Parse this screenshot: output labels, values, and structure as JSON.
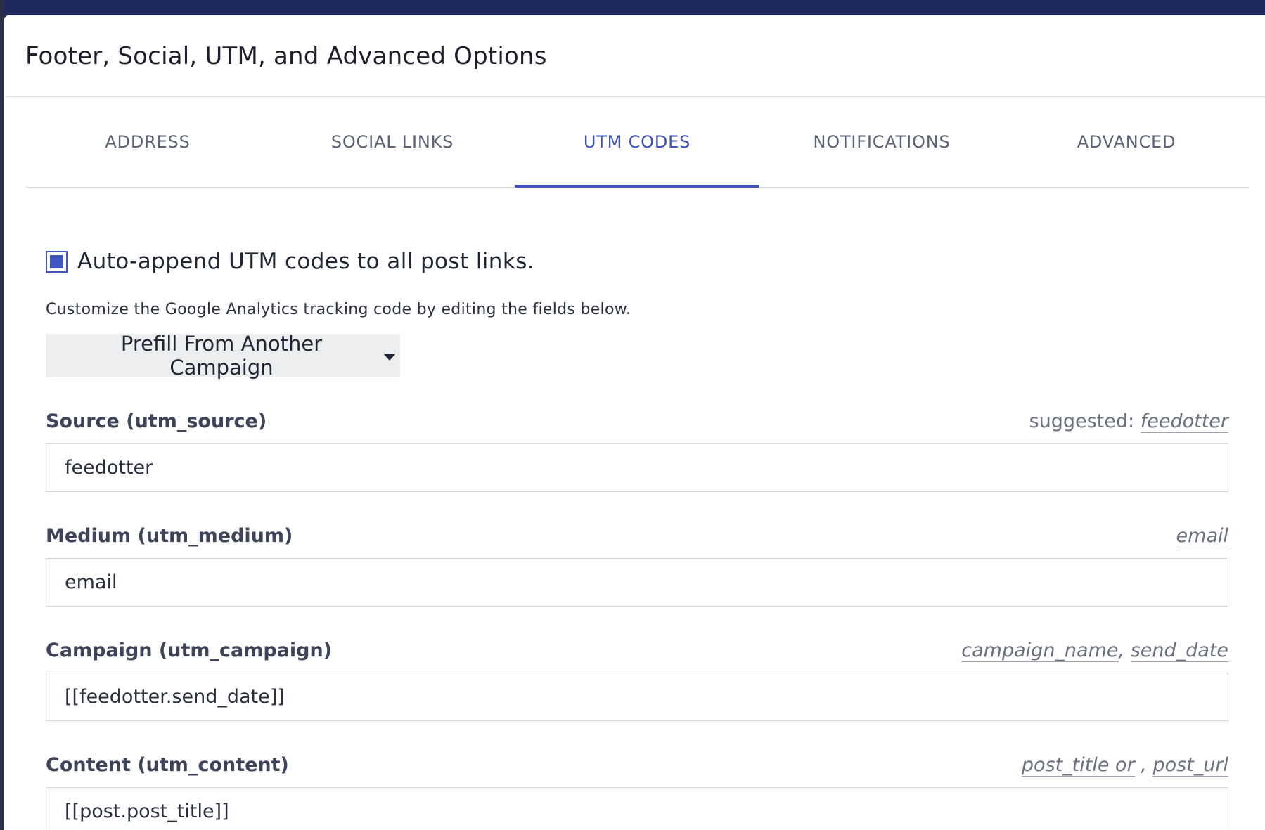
{
  "modal": {
    "title": "Footer, Social, UTM, and Advanced Options"
  },
  "tabs": [
    {
      "label": "ADDRESS",
      "active": false
    },
    {
      "label": "SOCIAL LINKS",
      "active": false
    },
    {
      "label": "UTM CODES",
      "active": true
    },
    {
      "label": "NOTIFICATIONS",
      "active": false
    },
    {
      "label": "ADVANCED",
      "active": false
    }
  ],
  "utm": {
    "auto_append_label": "Auto-append UTM codes to all post links.",
    "auto_append_checked": true,
    "helper_text": "Customize the Google Analytics tracking code by editing the fields below.",
    "prefill_label": "Prefill From Another Campaign",
    "fields": {
      "source": {
        "label": "Source (utm_source)",
        "suggested_prefix": "suggested:",
        "suggestions": [
          "feedotter"
        ],
        "value": "feedotter"
      },
      "medium": {
        "label": "Medium (utm_medium)",
        "suggestions": [
          "email"
        ],
        "value": "email"
      },
      "campaign": {
        "label": "Campaign (utm_campaign)",
        "suggestions": [
          "campaign_name",
          "send_date"
        ],
        "separator": ",",
        "value": "[[feedotter.send_date]]"
      },
      "content": {
        "label": "Content (utm_content)",
        "suggestions": [
          "post_title or",
          "post_url"
        ],
        "separator": ",",
        "value": "[[post.post_title]]"
      }
    }
  },
  "colors": {
    "accent": "#3f56c2",
    "backdrop": "#1e2a5c",
    "button_bg": "#eceef0"
  }
}
